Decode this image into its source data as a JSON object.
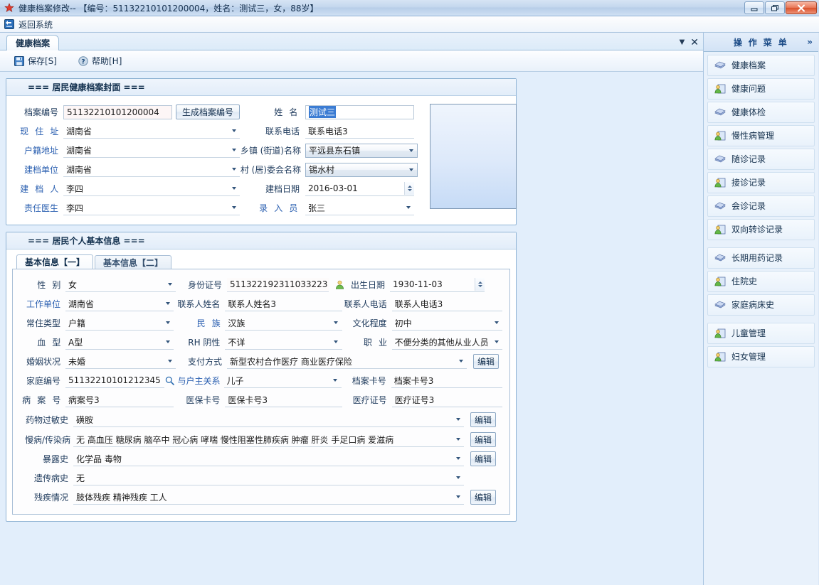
{
  "window": {
    "title": "健康档案修改-- 【编号：51132210101200004，姓名：测试三，女，88岁】",
    "minimize_label": "最小化",
    "restore_label": "还原",
    "close_label": "关闭"
  },
  "returnbar": {
    "label": "返回系统"
  },
  "tabstrip": {
    "tab_label": "健康档案",
    "dropdown_label": "▼",
    "close_label": "✕"
  },
  "toolbar": {
    "save_label": "保存[S]",
    "help_label": "帮助[H]"
  },
  "cover": {
    "section_title": "===  居民健康档案封面  ===",
    "fields": {
      "archive_no_label": "档案编号",
      "archive_no_value": "51132210101200004",
      "generate_btn": "生成档案编号",
      "name_label": "姓        名",
      "name_value": "测试三",
      "current_addr_label": "现 住 址",
      "current_addr_value": "湖南省",
      "phone_label": "联系电话",
      "phone_value": "联系电话3",
      "household_addr_label": "户籍地址",
      "household_addr_value": "湖南省",
      "town_label": "乡镇 (街道)名称",
      "town_value": "平远县东石镇",
      "unit_label": "建档单位",
      "unit_value": "湖南省",
      "village_label": "村 (居)委会名称",
      "village_value": "锡水村",
      "creator_label": "建 档 人",
      "creator_value": "李四",
      "create_date_label": "建档日期",
      "create_date_value": "2016-03-01",
      "doctor_label": "责任医生",
      "doctor_value": "李四",
      "recorder_label": "录 入 员",
      "recorder_value": "张三"
    }
  },
  "personal": {
    "section_title": "===  居民个人基本信息  ===",
    "tabs": [
      {
        "label": "基本信息【一】",
        "active": true
      },
      {
        "label": "基本信息【二】",
        "active": false
      }
    ],
    "fields": {
      "gender_label": "性        别",
      "gender_value": "女",
      "idcard_label": "身份证号",
      "idcard_value": "511322192311033223",
      "birth_label": "出生日期",
      "birth_value": "1930-11-03",
      "workunit_label": "工作单位",
      "workunit_value": "湖南省",
      "contact_name_label": "联系人姓名",
      "contact_name_value": "联系人姓名3",
      "contact_phone_label": "联系人电话",
      "contact_phone_value": "联系人电话3",
      "residence_type_label": "常住类型",
      "residence_type_value": "户籍",
      "ethnic_label": "民        族",
      "ethnic_value": "汉族",
      "education_label": "文化程度",
      "education_value": "初中",
      "blood_label": "血        型",
      "blood_value": "A型",
      "rh_label": "RH 阴性",
      "rh_value": "不详",
      "occupation_label": "职        业",
      "occupation_value": "不便分类的其他从业人员",
      "marital_label": "婚姻状况",
      "marital_value": "未婚",
      "payment_label": "支付方式",
      "payment_value": "新型农村合作医疗   商业医疗保险",
      "payment_edit": "编辑",
      "family_no_label": "家庭编号",
      "family_no_value": "51132210101212345",
      "relation_label": "与户主关系",
      "relation_value": "儿子",
      "file_card_label": "档案卡号",
      "file_card_value": "档案卡号3",
      "case_no_label": "病 案 号",
      "case_no_value": "病案号3",
      "insurance_card_label": "医保卡号",
      "insurance_card_value": "医保卡号3",
      "medical_cert_label": "医疗证号",
      "medical_cert_value": "医疗证号3",
      "allergy_label": "药物过敏史",
      "allergy_value": "磺胺",
      "allergy_edit": "编辑",
      "chronic_label": "慢病/传染病",
      "chronic_value": "无   高血压   糖尿病   脑卒中   冠心病   哮喘   慢性阻塞性肺疾病   肿瘤   肝炎   手足口病   爱滋病",
      "chronic_edit": "编辑",
      "exposure_label": "暴露史",
      "exposure_value": "化学品   毒物",
      "exposure_edit": "编辑",
      "hereditary_label": "遗传病史",
      "hereditary_value": "无",
      "disability_label": "残疾情况",
      "disability_value": "肢体残疾   精神残疾   工人",
      "disability_edit": "编辑"
    }
  },
  "menu": {
    "title": "操 作 菜 单",
    "expand_label": "»",
    "items": [
      {
        "label": "健康档案",
        "icon": "books-icon"
      },
      {
        "label": "健康问题",
        "icon": "person-card-icon"
      },
      {
        "label": "健康体检",
        "icon": "books-icon"
      },
      {
        "label": "慢性病管理",
        "icon": "person-card-icon"
      },
      {
        "label": "随诊记录",
        "icon": "books-icon"
      },
      {
        "label": "接诊记录",
        "icon": "person-card-icon"
      },
      {
        "label": "会诊记录",
        "icon": "books-icon"
      },
      {
        "label": "双向转诊记录",
        "icon": "person-card-icon"
      },
      {
        "label": "长期用药记录",
        "icon": "books-icon"
      },
      {
        "label": "住院史",
        "icon": "person-card-icon"
      },
      {
        "label": "家庭病床史",
        "icon": "books-icon"
      },
      {
        "label": "儿童管理",
        "icon": "person-card-icon"
      },
      {
        "label": "妇女管理",
        "icon": "person-card-icon"
      }
    ]
  },
  "colors": {
    "accent": "#2a5fb0",
    "panel_border": "#8fb3d4",
    "background": "#e2eefb",
    "selection": "#3b7cd3"
  }
}
